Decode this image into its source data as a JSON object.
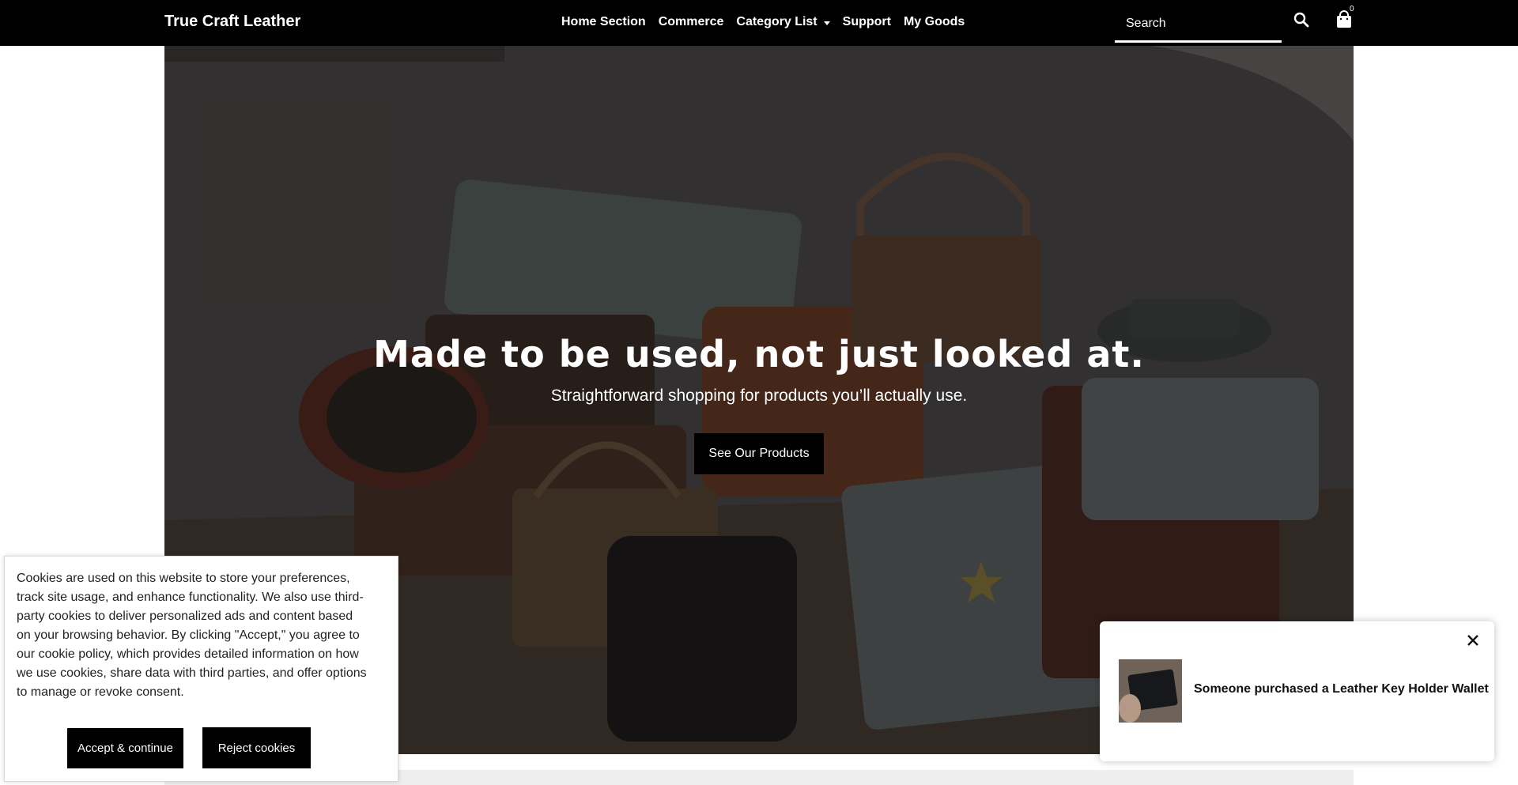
{
  "header": {
    "brand": "True Craft Leather",
    "nav": [
      {
        "label": "Home Section"
      },
      {
        "label": "Commerce"
      },
      {
        "label": "Category List"
      },
      {
        "label": "Support"
      },
      {
        "label": "My Goods"
      }
    ],
    "search_placeholder": "Search",
    "cart_count": "0",
    "search_icon": "search-icon",
    "cart_icon": "shopping-bag-icon"
  },
  "hero": {
    "title": "Made to be used, not just looked at.",
    "subtitle": "Straightforward shopping for products you’ll actually use.",
    "cta": "See Our Products"
  },
  "cookie": {
    "text": "Cookies are used on this website to store your preferences, track site usage, and enhance functionality. We also use third-party cookies to deliver personalized ads and content based on your browsing behavior. By clicking \"Accept,\" you agree to our cookie policy, which provides detailed information on how we use cookies, share data with third parties, and offer options to manage or revoke consent.",
    "accept": "Accept & continue",
    "reject": "Reject cookies"
  },
  "toast": {
    "text": "Someone purchased a Leather Key Holder Wallet",
    "close_icon": "close-icon"
  },
  "colors": {
    "header_bg": "#000000",
    "button_bg": "#000000",
    "text_light": "#ffffff"
  }
}
